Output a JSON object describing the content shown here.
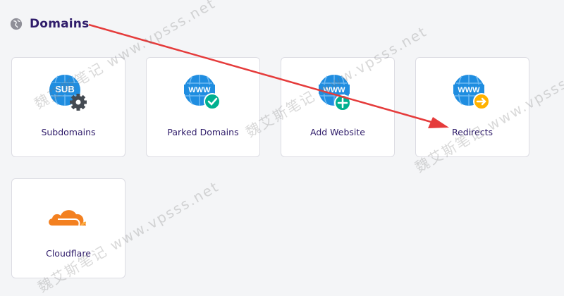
{
  "header": {
    "title": "Domains",
    "icon": "globe-icon"
  },
  "cards": [
    {
      "label": "Subdomains",
      "icon": "subdomain-gear-icon",
      "badge_text": "SUB",
      "badge_color": "#8f8f96"
    },
    {
      "label": "Parked Domains",
      "icon": "www-check-icon",
      "badge_text": "WWW",
      "badge_color": "#00b090"
    },
    {
      "label": "Add Website",
      "icon": "www-plus-icon",
      "badge_text": "WWW",
      "badge_color": "#00b090"
    },
    {
      "label": "Redirects",
      "icon": "www-redirect-icon",
      "badge_text": "WWW",
      "badge_color": "#ffb200"
    },
    {
      "label": "Cloudflare",
      "icon": "cloudflare-icon"
    }
  ],
  "watermark": {
    "text": "魏艾斯笔记 www.vpsss.net"
  },
  "colors": {
    "accent_blue": "#1f8de0",
    "title_purple": "#2f1c6a",
    "arrow_red": "#e53b3b",
    "cloudflare_orange": "#f38020"
  }
}
